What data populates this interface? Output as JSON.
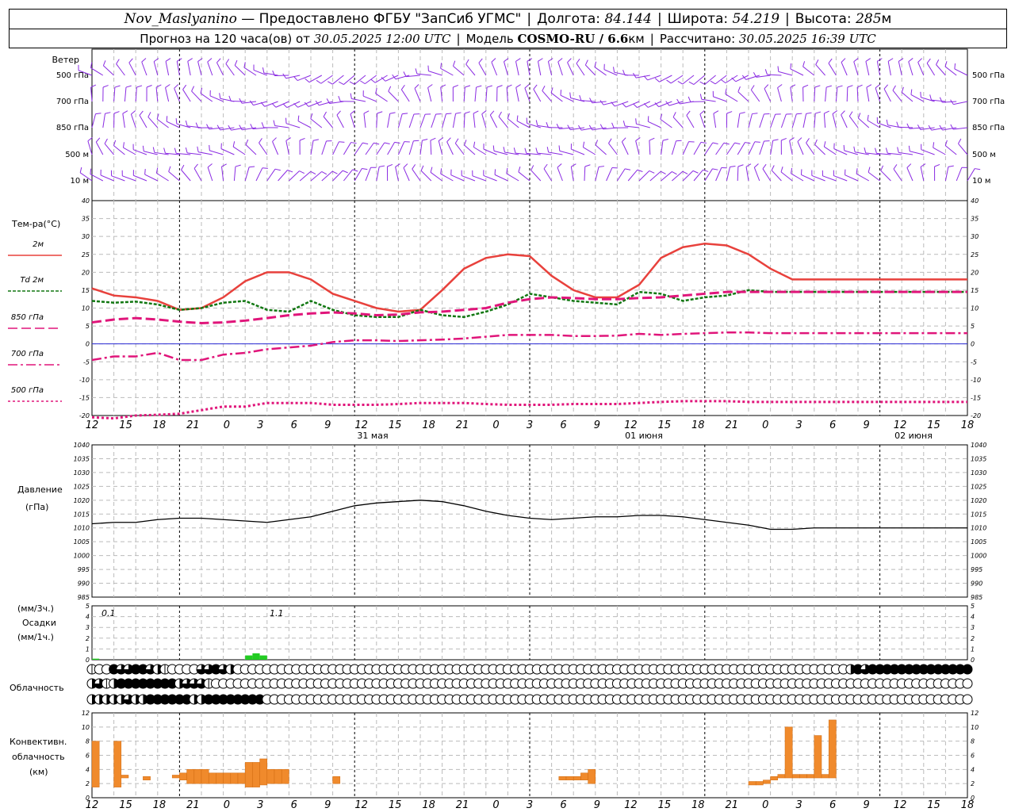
{
  "header": {
    "station": "Nov_Maslyanino",
    "provider": "— Предоставлено ФГБУ \"ЗапСиб УГМС\"",
    "lon_label": "Долгота:",
    "lon_value": "84.144",
    "lat_label": "Широта:",
    "lat_value": "54.219",
    "alt_label": "Высота:",
    "alt_value": "285",
    "alt_unit": "м",
    "forecast_prefix": "Прогноз на 120 часа(ов) от",
    "forecast_start": "30.05.2025 12:00 UTC",
    "model_label": "Модель",
    "model_name": "COSMO-RU / 6.6",
    "model_unit": "км",
    "calc_label": "Рассчитано:",
    "calc_time": "30.05.2025 16:39 UTC"
  },
  "wind_panel": {
    "title": "Ветер",
    "levels": [
      "500 гПа",
      "700 гПа",
      "850 гПа",
      "500 м",
      "10 м"
    ],
    "barb_color": "#8a2be2"
  },
  "temp_panel": {
    "title": "Тем-ра(°C)",
    "legend": [
      {
        "label": "2м",
        "color": "#e8413c"
      },
      {
        "label": "Td 2м",
        "color": "#117711"
      },
      {
        "label": "850 гПа",
        "color": "#e0157a"
      },
      {
        "label": "700 гПа",
        "color": "#e0157a"
      },
      {
        "label": "500 гПа",
        "color": "#e0157a"
      }
    ],
    "yticks": [
      "40",
      "35",
      "30",
      "25",
      "20",
      "15",
      "10",
      "5",
      "0",
      "-5",
      "-10",
      "-15",
      "-20"
    ]
  },
  "x_axis": {
    "hour_labels": [
      "12",
      "15",
      "18",
      "21",
      "0",
      "3",
      "6",
      "9",
      "12",
      "15",
      "18",
      "21",
      "0",
      "3",
      "6",
      "9",
      "12",
      "15",
      "18",
      "21",
      "0",
      "3",
      "6",
      "9",
      "12",
      "15",
      "18"
    ],
    "day_labels": [
      "31 мая",
      "01 июня",
      "02 июня"
    ]
  },
  "pressure_panel": {
    "title_line1": "Давление",
    "title_line2": "(гПа)",
    "yticks": [
      "1040",
      "1035",
      "1030",
      "1025",
      "1020",
      "1015",
      "1010",
      "1005",
      "1000",
      "995",
      "990",
      "985"
    ]
  },
  "precip_panel": {
    "title_line1": "(мм/3ч.)",
    "title_line2": "Осадки",
    "title_line3": "(мм/1ч.)",
    "yticks": [
      "5",
      "4",
      "3",
      "2",
      "1",
      "0"
    ],
    "annotations": [
      "0.1",
      "1.1"
    ],
    "bar_color": "#22cc22"
  },
  "cloud_panel": {
    "title": "Облачность"
  },
  "conv_panel": {
    "title_line1": "Конвективн.",
    "title_line2": "облачность",
    "title_line3": "(км)",
    "yticks": [
      "12",
      "10",
      "8",
      "6",
      "4",
      "2",
      "0"
    ],
    "bar_color": "#f08a2c"
  },
  "chart_data": {
    "type": "line",
    "x_hours_from_start": [
      0,
      3,
      6,
      9,
      12,
      15,
      18,
      21,
      24,
      27,
      30,
      33,
      36,
      39,
      42,
      45,
      48,
      51,
      54,
      57,
      60,
      63,
      66,
      69,
      72,
      75,
      78,
      81,
      84,
      87,
      90,
      93,
      96,
      99,
      102,
      105,
      108,
      111,
      114,
      117,
      120
    ],
    "series": [
      {
        "name": "2м",
        "values": [
          15.5,
          13.5,
          13,
          12,
          9.5,
          10,
          13,
          17.5,
          20,
          20,
          18,
          14,
          12,
          10,
          9,
          9.5,
          15,
          21,
          24,
          25,
          24.5,
          19,
          15,
          13,
          13,
          16.5,
          24,
          27,
          28,
          27.5,
          25,
          21,
          18,
          18,
          18,
          18,
          18,
          18,
          18,
          18,
          18
        ]
      },
      {
        "name": "Td 2м",
        "values": [
          12,
          11.5,
          11.8,
          11,
          9.5,
          10,
          11.5,
          12,
          9.5,
          9,
          12,
          9.5,
          8,
          7.5,
          7.5,
          9.5,
          8,
          7.5,
          9,
          11,
          14,
          13,
          12,
          11.5,
          11,
          14.5,
          14,
          12,
          13,
          13.5,
          15,
          14.5,
          14.5,
          14.5,
          14.5,
          14.5,
          14.5,
          14.5,
          14.5,
          14.5,
          14.5
        ]
      },
      {
        "name": "850 гПа",
        "values": [
          6,
          6.8,
          7.2,
          6.8,
          6.2,
          5.8,
          6,
          6.5,
          7.2,
          8,
          8.5,
          8.8,
          8.5,
          8,
          8.2,
          8.8,
          9,
          9.5,
          10,
          11.5,
          12.5,
          13,
          12.8,
          12.5,
          12.5,
          12.8,
          13,
          13.5,
          14,
          14.5,
          14.5,
          14.5,
          14.5,
          14.5,
          14.5,
          14.5,
          14.5,
          14.5,
          14.5,
          14.5,
          14.5
        ]
      },
      {
        "name": "700 гПа",
        "values": [
          -4.5,
          -3.5,
          -3.5,
          -2.5,
          -4.5,
          -4.5,
          -3,
          -2.5,
          -1.5,
          -1,
          -0.5,
          0.5,
          1,
          1,
          0.8,
          1,
          1.2,
          1.5,
          2,
          2.5,
          2.5,
          2.5,
          2.2,
          2.2,
          2.3,
          2.8,
          2.5,
          2.8,
          3,
          3.2,
          3.2,
          3,
          3,
          3,
          3,
          3,
          3,
          3,
          3,
          3,
          3
        ]
      },
      {
        "name": "500 гПа",
        "values": [
          -20.5,
          -20.8,
          -20,
          -19.8,
          -19.5,
          -18.5,
          -17.5,
          -17.5,
          -16.5,
          -16.5,
          -16.5,
          -17,
          -17,
          -17,
          -16.8,
          -16.5,
          -16.5,
          -16.5,
          -16.8,
          -17,
          -17,
          -17,
          -16.8,
          -16.8,
          -16.8,
          -16.5,
          -16.2,
          -16,
          -16,
          -16,
          -16.2,
          -16.2,
          -16.2,
          -16.2,
          -16.2,
          -16.2,
          -16.2,
          -16.2,
          -16.2,
          -16.2,
          -16.2
        ]
      }
    ],
    "pressure_series": {
      "name": "",
      "x": [
        0,
        3,
        6,
        9,
        12,
        15,
        18,
        21,
        24,
        27,
        30,
        33,
        36,
        39,
        42,
        45,
        48,
        51,
        54,
        57,
        60,
        63,
        66,
        69,
        72,
        75,
        78,
        81,
        84,
        87,
        90,
        93,
        96,
        99,
        102,
        105,
        108,
        111,
        114,
        117,
        120
      ],
      "values": [
        1011.5,
        1012,
        1012,
        1013,
        1013.5,
        1013.5,
        1013,
        1012.5,
        1012,
        1013,
        1014,
        1016,
        1018,
        1019,
        1019.5,
        1020,
        1019.5,
        1018,
        1016,
        1014.5,
        1013.5,
        1013,
        1013.5,
        1014,
        1014,
        1014.5,
        1014.5,
        1014,
        1013,
        1012,
        1011,
        1009.5,
        1009.5,
        1010,
        1010,
        1010,
        1010,
        1010,
        1010,
        1010,
        1010
      ]
    },
    "precip_bars": [
      {
        "hour": 0,
        "value": 0.1
      },
      {
        "hour": 21,
        "value": 0.4
      },
      {
        "hour": 22,
        "value": 0.6
      },
      {
        "hour": 23,
        "value": 0.4
      }
    ],
    "conv_bars": [
      {
        "from": 0,
        "to": 1,
        "bottom": 1.5,
        "top": 8
      },
      {
        "from": 3,
        "to": 4,
        "bottom": 1.5,
        "top": 8
      },
      {
        "from": 4,
        "to": 5,
        "bottom": 2.8,
        "top": 3.2
      },
      {
        "from": 7,
        "to": 8,
        "bottom": 2.5,
        "top": 3
      },
      {
        "from": 11,
        "to": 12,
        "bottom": 2.8,
        "top": 3.2
      },
      {
        "from": 12,
        "to": 13,
        "bottom": 2.5,
        "top": 3.5
      },
      {
        "from": 13,
        "to": 14,
        "bottom": 2,
        "top": 4
      },
      {
        "from": 14,
        "to": 15,
        "bottom": 2,
        "top": 4
      },
      {
        "from": 15,
        "to": 16,
        "bottom": 2,
        "top": 4
      },
      {
        "from": 16,
        "to": 17,
        "bottom": 2,
        "top": 3.5
      },
      {
        "from": 17,
        "to": 18,
        "bottom": 2,
        "top": 3.5
      },
      {
        "from": 18,
        "to": 19,
        "bottom": 2,
        "top": 3.5
      },
      {
        "from": 19,
        "to": 20,
        "bottom": 2,
        "top": 3.5
      },
      {
        "from": 20,
        "to": 21,
        "bottom": 2,
        "top": 3.5
      },
      {
        "from": 21,
        "to": 22,
        "bottom": 1.5,
        "top": 5
      },
      {
        "from": 22,
        "to": 23,
        "bottom": 1.5,
        "top": 5
      },
      {
        "from": 23,
        "to": 24,
        "bottom": 1.8,
        "top": 5.5
      },
      {
        "from": 24,
        "to": 25,
        "bottom": 2,
        "top": 4
      },
      {
        "from": 25,
        "to": 26,
        "bottom": 2,
        "top": 4
      },
      {
        "from": 26,
        "to": 27,
        "bottom": 2,
        "top": 4
      },
      {
        "from": 33,
        "to": 34,
        "bottom": 2,
        "top": 3
      },
      {
        "from": 64,
        "to": 65,
        "bottom": 2.5,
        "top": 3
      },
      {
        "from": 65,
        "to": 66,
        "bottom": 2.5,
        "top": 3
      },
      {
        "from": 66,
        "to": 67,
        "bottom": 2.5,
        "top": 3
      },
      {
        "from": 67,
        "to": 68,
        "bottom": 2.5,
        "top": 3.5
      },
      {
        "from": 68,
        "to": 69,
        "bottom": 2,
        "top": 4
      },
      {
        "from": 90,
        "to": 91,
        "bottom": 1.8,
        "top": 2.3
      },
      {
        "from": 91,
        "to": 92,
        "bottom": 1.8,
        "top": 2.3
      },
      {
        "from": 92,
        "to": 93,
        "bottom": 2,
        "top": 2.5
      },
      {
        "from": 93,
        "to": 94,
        "bottom": 2.5,
        "top": 3
      },
      {
        "from": 94,
        "to": 95,
        "bottom": 2.8,
        "top": 3.3
      },
      {
        "from": 95,
        "to": 96,
        "bottom": 2.8,
        "top": 10
      },
      {
        "from": 96,
        "to": 97,
        "bottom": 2.8,
        "top": 3.3
      },
      {
        "from": 97,
        "to": 98,
        "bottom": 2.8,
        "top": 3.3
      },
      {
        "from": 98,
        "to": 99,
        "bottom": 2.8,
        "top": 3.3
      },
      {
        "from": 99,
        "to": 100,
        "bottom": 2.8,
        "top": 8.8
      },
      {
        "from": 100,
        "to": 101,
        "bottom": 2.8,
        "top": 3.3
      },
      {
        "from": 101,
        "to": 102,
        "bottom": 2.8,
        "top": 11
      }
    ],
    "cloud_rows": {
      "row1": [
        1,
        0,
        0,
        4,
        3,
        3,
        4,
        4,
        3,
        2,
        1,
        0,
        0,
        0,
        0,
        3,
        3,
        4,
        3,
        2,
        0,
        0,
        0,
        0,
        0,
        0,
        0,
        0,
        0,
        0,
        0,
        0,
        0,
        0,
        0,
        0,
        0,
        0,
        0,
        0,
        0,
        0,
        0,
        0,
        0,
        0,
        0,
        0,
        0,
        0,
        0,
        0,
        0,
        0,
        0,
        0,
        0,
        0,
        0,
        0,
        0,
        0,
        0,
        0,
        0,
        0,
        0,
        0,
        0,
        0,
        0,
        0,
        0,
        0,
        0,
        0,
        0,
        0,
        0,
        0,
        0,
        0,
        0,
        0,
        0,
        0,
        0,
        0,
        0,
        0,
        0,
        0,
        0,
        0,
        0,
        0,
        0,
        0,
        0,
        0,
        0,
        0,
        0,
        0,
        2,
        4,
        3,
        4,
        4,
        4,
        4,
        4,
        4,
        4,
        4,
        4,
        4,
        4,
        4,
        4,
        4
      ],
      "row2": [
        2,
        3,
        1,
        2,
        4,
        4,
        4,
        4,
        4,
        4,
        4,
        4,
        2,
        3,
        3,
        3,
        1,
        0,
        0,
        0,
        0,
        0,
        0,
        0,
        0,
        0,
        0,
        0,
        0,
        0,
        0,
        0,
        0,
        0,
        0,
        0,
        0,
        0,
        0,
        0,
        0,
        0,
        0,
        0,
        0,
        0,
        0,
        0,
        0,
        0,
        0,
        0,
        0,
        0,
        0,
        0,
        0,
        0,
        0,
        0,
        0,
        0,
        0,
        0,
        0,
        0,
        0,
        0,
        0,
        0,
        0,
        0,
        0,
        0,
        0,
        0,
        0,
        0,
        0,
        0,
        0,
        0,
        0,
        0,
        0,
        0,
        0,
        0,
        0,
        0,
        0,
        0,
        0,
        0,
        0,
        0,
        0,
        0,
        0,
        0,
        0,
        0,
        0,
        0,
        0,
        0,
        0,
        0,
        0,
        0,
        0,
        0,
        0,
        0,
        0,
        0,
        0,
        0,
        0,
        0,
        0
      ],
      "row3": [
        2,
        2,
        2,
        2,
        2,
        3,
        2,
        2,
        4,
        4,
        4,
        4,
        4,
        4,
        2,
        2,
        4,
        4,
        4,
        4,
        4,
        4,
        4,
        4,
        0,
        0,
        0,
        0,
        0,
        0,
        0,
        0,
        0,
        0,
        0,
        0,
        0,
        0,
        0,
        0,
        0,
        0,
        0,
        0,
        0,
        0,
        0,
        0,
        0,
        0,
        0,
        0,
        0,
        0,
        0,
        0,
        0,
        0,
        0,
        0,
        0,
        0,
        0,
        0,
        0,
        0,
        0,
        0,
        0,
        0,
        0,
        0,
        0,
        0,
        0,
        0,
        0,
        0,
        0,
        0,
        0,
        0,
        0,
        0,
        0,
        0,
        0,
        0,
        0,
        0,
        0,
        0,
        0,
        0,
        0,
        0,
        0,
        0,
        0,
        0,
        0,
        0,
        0,
        0,
        0,
        0,
        0,
        0,
        0,
        0,
        0,
        0,
        0,
        0,
        0,
        0,
        0,
        0,
        0,
        0,
        0
      ]
    },
    "temp_ylim": [
      -20,
      40
    ],
    "pressure_ylim": [
      985,
      1040
    ],
    "precip_ylim": [
      0,
      5
    ],
    "conv_ylim": [
      0,
      12
    ],
    "grid": true
  }
}
